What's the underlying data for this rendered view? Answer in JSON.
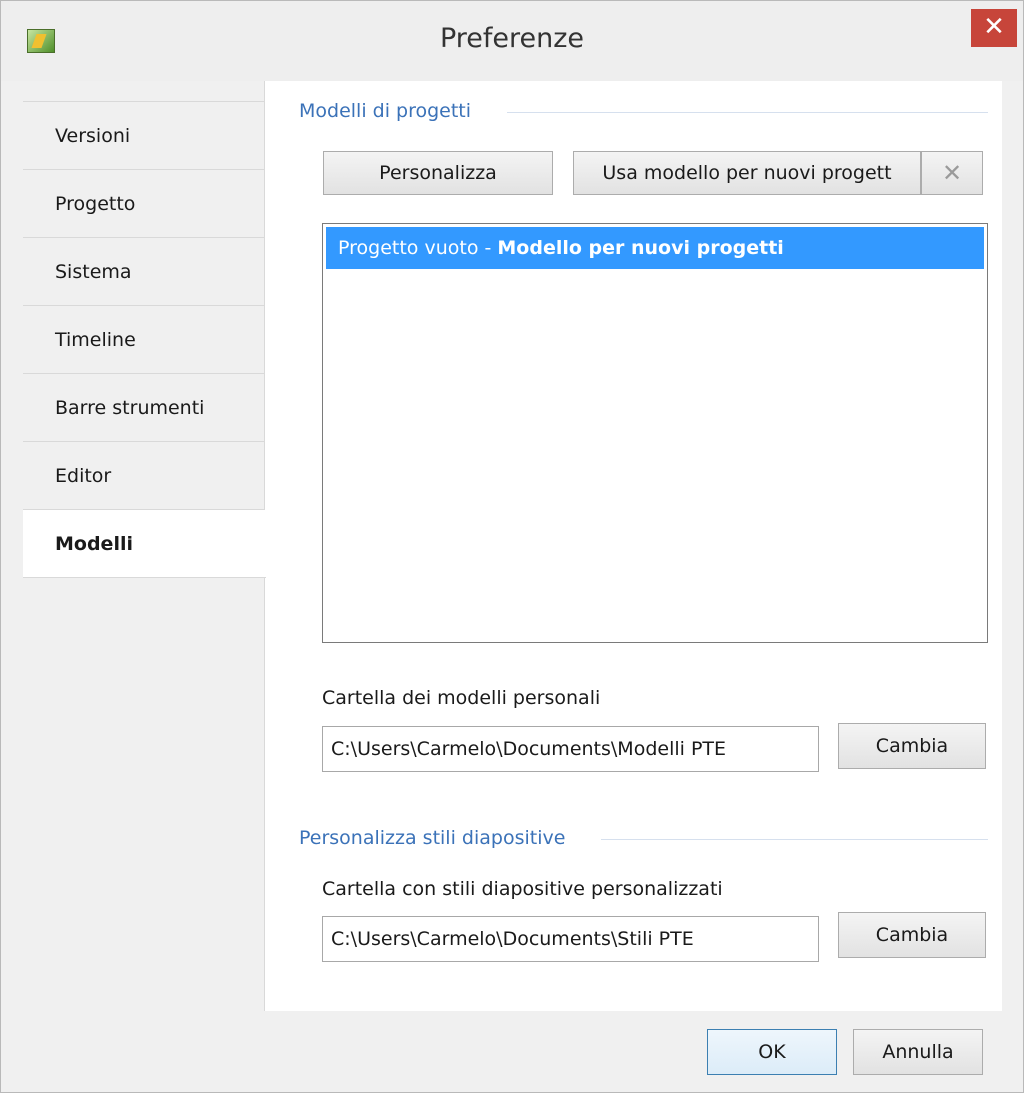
{
  "window": {
    "title": "Preferenze",
    "close_glyph": "✕"
  },
  "sidebar": {
    "items": [
      {
        "label": "Versioni"
      },
      {
        "label": "Progetto"
      },
      {
        "label": "Sistema"
      },
      {
        "label": "Timeline"
      },
      {
        "label": "Barre strumenti"
      },
      {
        "label": "Editor"
      },
      {
        "label": "Modelli",
        "selected": true
      }
    ]
  },
  "templates": {
    "group_title": "Modelli di progetti",
    "customize_label": "Personalizza",
    "use_for_new_label": "Usa modello per nuovi progett",
    "delete_glyph": "✕",
    "list": [
      {
        "name": "Progetto vuoto - ",
        "note": "Modello per nuovi progetti",
        "selected": true
      }
    ],
    "personal_folder_label": "Cartella dei modelli personali",
    "personal_folder_value": "C:\\Users\\Carmelo\\Documents\\Modelli PTE",
    "change_label": "Cambia"
  },
  "slide_styles": {
    "group_title": "Personalizza stili diapositive",
    "folder_label": "Cartella con stili diapositive personalizzati",
    "folder_value": "C:\\Users\\Carmelo\\Documents\\Stili PTE",
    "change_label": "Cambia"
  },
  "footer": {
    "ok_label": "OK",
    "cancel_label": "Annulla"
  },
  "colors": {
    "accent": "#3b72b8",
    "selection": "#3399ff",
    "close": "#c7453a"
  }
}
